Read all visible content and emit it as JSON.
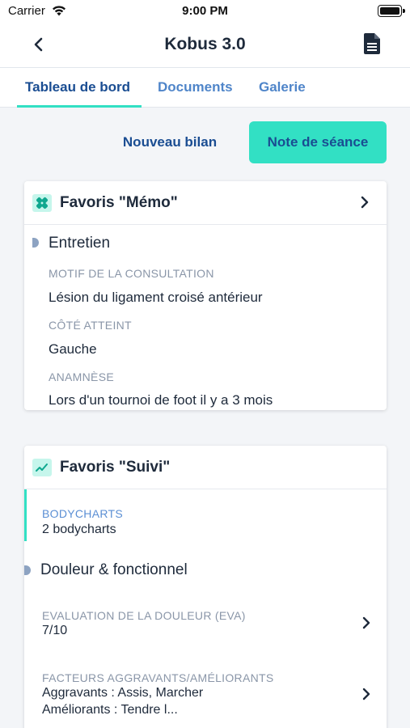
{
  "status": {
    "carrier": "Carrier",
    "time": "9:00 PM"
  },
  "nav": {
    "title": "Kobus 3.0"
  },
  "tabs": [
    {
      "label": "Tableau de bord",
      "active": true
    },
    {
      "label": "Documents",
      "active": false
    },
    {
      "label": "Galerie",
      "active": false
    }
  ],
  "actions": {
    "nouveau_bilan": "Nouveau bilan",
    "note_seance": "Note de séance"
  },
  "memo": {
    "title": "Favoris \"Mémo\"",
    "section": "Entretien",
    "fields": [
      {
        "label": "MOTIF DE LA CONSULTATION",
        "value": "Lésion du ligament croisé antérieur"
      },
      {
        "label": "CÔTÉ ATTEINT",
        "value": "Gauche"
      },
      {
        "label": "ANAMNÈSE",
        "value": "Lors d'un tournoi de foot il y a 3 mois"
      }
    ]
  },
  "suivi": {
    "title": "Favoris \"Suivi\"",
    "bodycharts": {
      "label": "BODYCHARTS",
      "value": "2 bodycharts"
    },
    "section": "Douleur & fonctionnel",
    "eva": {
      "label": "EVALUATION DE LA DOULEUR (EVA)",
      "value": "7/10"
    },
    "facteurs": {
      "label": "FACTEURS AGGRAVANTS/AMÉLIORANTS",
      "value_line1": "Aggravants : Assis, Marcher",
      "value_line2": "Améliorants : Tendre l..."
    }
  },
  "colors": {
    "accent": "#32e0c4",
    "primary": "#1a4d92",
    "link": "#4f85c9",
    "background": "#f3f5f8"
  },
  "icons": [
    "wifi-icon",
    "battery-icon",
    "back-chevron-icon",
    "document-icon",
    "bandage-icon",
    "trend-chart-icon",
    "chevron-right-icon"
  ]
}
